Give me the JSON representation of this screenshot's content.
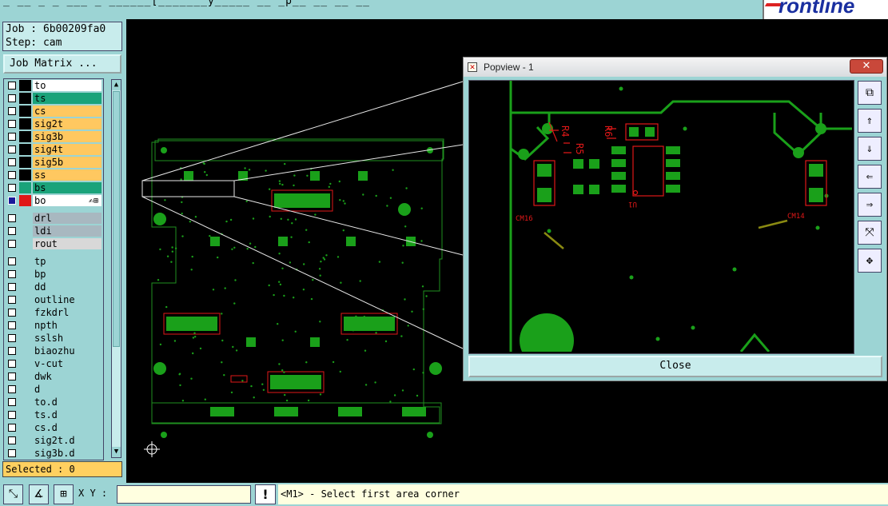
{
  "menu_bar": {
    "text": "_ __ _ _ ___ _ ______[_______y_____ __ _p__ __ __ __"
  },
  "logo": {
    "text": "rontline"
  },
  "job": {
    "job_line": "Job : 6b00209fa0",
    "step_line": "Step: cam"
  },
  "job_matrix_label": "Job Matrix ...",
  "layers_group1": [
    {
      "name": "to",
      "color": "#ffffff",
      "swatch": "#000000"
    },
    {
      "name": "ts",
      "color": "#1aa37a",
      "swatch": "#000000"
    },
    {
      "name": "cs",
      "color": "#ffc860",
      "swatch": "#000000"
    },
    {
      "name": "sig2t",
      "color": "#ffc860",
      "swatch": "#000000"
    },
    {
      "name": "sig3b",
      "color": "#ffc860",
      "swatch": "#000000"
    },
    {
      "name": "sig4t",
      "color": "#ffc860",
      "swatch": "#000000"
    },
    {
      "name": "sig5b",
      "color": "#ffc860",
      "swatch": "#000000"
    },
    {
      "name": "ss",
      "color": "#ffc860",
      "swatch": "#000000"
    },
    {
      "name": "bs",
      "color": "#1aa37a",
      "swatch": "#1aa37a"
    },
    {
      "name": "bo",
      "color": "#ffffff",
      "swatch": "#e01818",
      "active": true,
      "tool": "✍⊞"
    }
  ],
  "layers_group2": [
    {
      "name": "drl",
      "color": "#a8b8c0"
    },
    {
      "name": "ldi",
      "color": "#a8b8c0"
    },
    {
      "name": "rout",
      "color": "#d8d8d8"
    }
  ],
  "layers_group3": [
    "tp",
    "bp",
    "dd",
    "outline",
    "fzkdrl",
    "npth",
    "sslsh",
    "biaozhu",
    "v-cut",
    "dwk",
    "d",
    "to.d",
    "ts.d",
    "cs.d",
    "sig2t.d",
    "sig3b.d"
  ],
  "selected_label": "Selected : 0",
  "bottom": {
    "xy_label": "X Y :",
    "xy_value": "",
    "warn": "!",
    "status": "<M1> - Select first area corner"
  },
  "popup": {
    "title": "Popview - 1",
    "close_label": "Close"
  },
  "pcb_labels": {
    "left": "CM16",
    "right": "CM14",
    "u": "U1",
    "r1": "R4",
    "r2": "R5",
    "r3": "R6"
  },
  "colors": {
    "panel": "#9cd4d4",
    "trace": "#1f8f1f",
    "pad": "#1aa01a",
    "silk": "#e01818",
    "status_bg": "#ffffe0",
    "selected_bg": "#ffd060"
  },
  "icons": {
    "bottom_tools": [
      "zoom-area-icon",
      "measure-icon",
      "grid-icon"
    ],
    "popup_tools": [
      "fit-icon",
      "pan-up-icon",
      "pan-down-icon",
      "pan-left-icon",
      "pan-right-icon",
      "zoom-out-icon",
      "zoom-in-icon"
    ]
  }
}
